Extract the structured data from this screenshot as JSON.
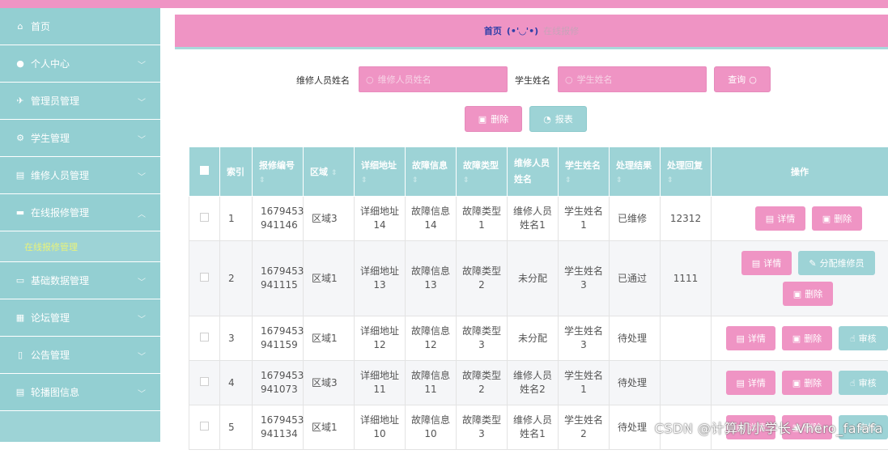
{
  "sidebar": {
    "items": [
      {
        "label": "首页",
        "icon": "home-icon",
        "glyph": "⌂",
        "chevron": false
      },
      {
        "label": "个人中心",
        "icon": "user-icon",
        "glyph": "●",
        "chevron": true
      },
      {
        "label": "管理员管理",
        "icon": "send-icon",
        "glyph": "✈",
        "chevron": true
      },
      {
        "label": "学生管理",
        "icon": "cog-icon",
        "glyph": "⚙",
        "chevron": true
      },
      {
        "label": "维修人员管理",
        "icon": "clipboard-icon",
        "glyph": "▤",
        "chevron": true
      },
      {
        "label": "在线报修管理",
        "icon": "chat-icon",
        "glyph": "▬",
        "chevron": true,
        "open": true
      },
      {
        "label": "基础数据管理",
        "icon": "monitor-icon",
        "glyph": "▭",
        "chevron": true
      },
      {
        "label": "论坛管理",
        "icon": "grid-icon",
        "glyph": "▦",
        "chevron": true
      },
      {
        "label": "公告管理",
        "icon": "phone-icon",
        "glyph": "▯",
        "chevron": true
      },
      {
        "label": "轮播图信息",
        "icon": "document-icon",
        "glyph": "▤",
        "chevron": true
      }
    ],
    "submenu": "在线报修管理"
  },
  "breadcrumb": {
    "home": "首页",
    "face": "(•'◡'•)",
    "current": "在线报修"
  },
  "search": {
    "repair_label": "维修人员姓名",
    "repair_placeholder": "维修人员姓名",
    "student_label": "学生姓名",
    "student_placeholder": "学生姓名",
    "query_btn": "查询"
  },
  "actions": {
    "delete_btn": "删除",
    "report_btn": "报表"
  },
  "table": {
    "headers": [
      "索引",
      "报修编号",
      "区域",
      "详细地址",
      "故障信息",
      "故障类型",
      "维修人员姓名",
      "学生姓名",
      "处理结果",
      "处理回复",
      "操作"
    ],
    "rows": [
      {
        "idx": "1",
        "no1": "1679453",
        "no2": "941146",
        "area": "区域3",
        "addr1": "详细地址",
        "addr2": "14",
        "info1": "故障信息",
        "info2": "14",
        "type1": "故障类型",
        "type2": "1",
        "rep1": "维修人员",
        "rep2": "姓名1",
        "stu1": "学生姓名",
        "stu2": "1",
        "result": "已维修",
        "reply": "12312"
      },
      {
        "idx": "2",
        "no1": "1679453",
        "no2": "941115",
        "area": "区域1",
        "addr1": "详细地址",
        "addr2": "13",
        "info1": "故障信息",
        "info2": "13",
        "type1": "故障类型",
        "type2": "2",
        "rep1": "未分配",
        "rep2": "",
        "stu1": "学生姓名",
        "stu2": "3",
        "result": "已通过",
        "reply": "1111"
      },
      {
        "idx": "3",
        "no1": "1679453",
        "no2": "941159",
        "area": "区域1",
        "addr1": "详细地址",
        "addr2": "12",
        "info1": "故障信息",
        "info2": "12",
        "type1": "故障类型",
        "type2": "3",
        "rep1": "未分配",
        "rep2": "",
        "stu1": "学生姓名",
        "stu2": "3",
        "result": "待处理",
        "reply": ""
      },
      {
        "idx": "4",
        "no1": "1679453",
        "no2": "941073",
        "area": "区域3",
        "addr1": "详细地址",
        "addr2": "11",
        "info1": "故障信息",
        "info2": "11",
        "type1": "故障类型",
        "type2": "2",
        "rep1": "维修人员",
        "rep2": "姓名2",
        "stu1": "学生姓名",
        "stu2": "1",
        "result": "待处理",
        "reply": ""
      },
      {
        "idx": "5",
        "no1": "1679453",
        "no2": "941134",
        "area": "区域1",
        "addr1": "详细地址",
        "addr2": "10",
        "info1": "故障信息",
        "info2": "10",
        "type1": "故障类型",
        "type2": "3",
        "rep1": "维修人员",
        "rep2": "姓名1",
        "stu1": "学生姓名",
        "stu2": "2",
        "result": "待处理",
        "reply": ""
      }
    ],
    "ops": {
      "detail": "详情",
      "delete": "删除",
      "assign": "分配维修员",
      "audit": "审核"
    }
  },
  "watermark": "CSDN @计算机小学长-Vhero_fafafa",
  "colors": {
    "pink": "#ef94c4",
    "teal": "#9dd3d6",
    "navy": "#2f3fa8"
  }
}
